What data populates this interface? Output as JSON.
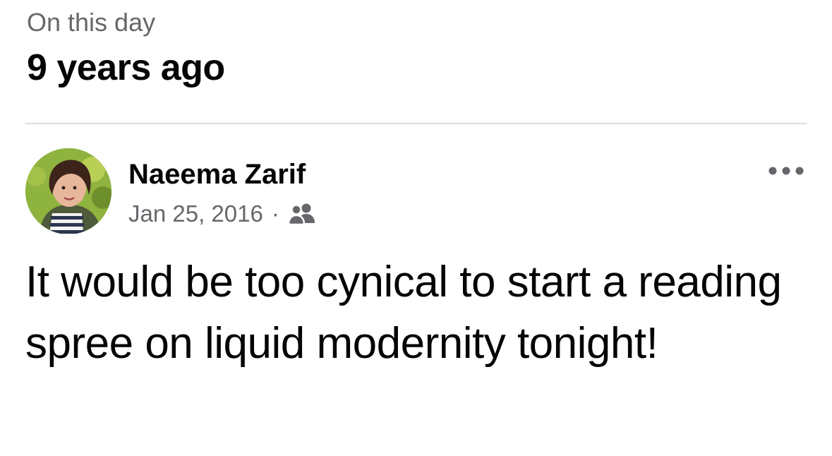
{
  "header": {
    "label": "On this day",
    "title": "9 years ago"
  },
  "post": {
    "author": {
      "name": "Naeema Zarif",
      "avatar": "profile-photo"
    },
    "date": "Jan 25, 2016",
    "separator": "·",
    "audience_icon": "friends-icon",
    "more_icon": "more-dots-icon",
    "text": "It would be too cynical to start a reading spree on liquid modernity tonight!"
  },
  "colors": {
    "text_primary": "#050505",
    "text_secondary": "#65676b",
    "divider": "#dadde1"
  }
}
